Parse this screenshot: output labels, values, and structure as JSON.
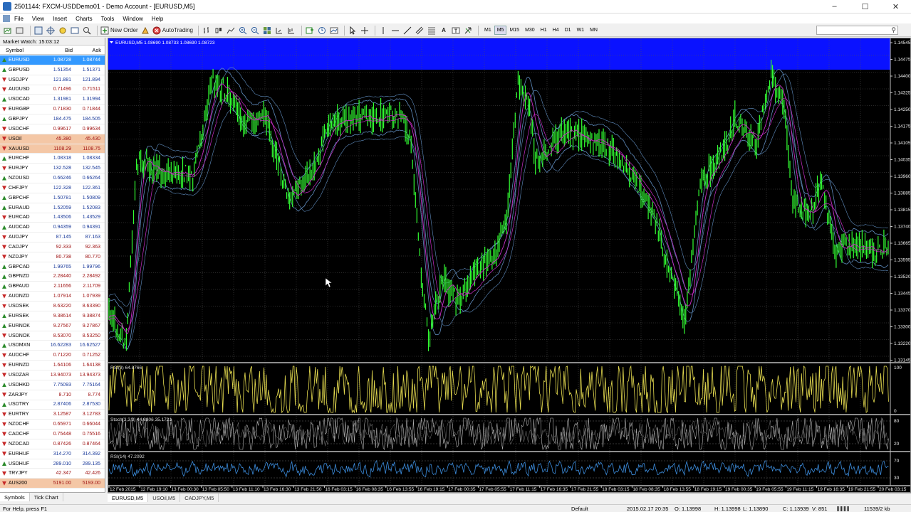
{
  "window": {
    "title": "2501144: FXCM-USDDemo01 - Demo Account - [EURUSD,M5]"
  },
  "menu": [
    "File",
    "View",
    "Insert",
    "Charts",
    "Tools",
    "Window",
    "Help"
  ],
  "toolbar": {
    "new_order": "New Order",
    "autotrading": "AutoTrading",
    "text_tool": "A",
    "timeframes": [
      "M1",
      "M5",
      "M15",
      "M30",
      "H1",
      "H4",
      "D1",
      "W1",
      "MN"
    ],
    "active_timeframe": "M5"
  },
  "market_watch": {
    "title": "Market Watch: 15:03:12",
    "headers": {
      "symbol": "Symbol",
      "bid": "Bid",
      "ask": "Ask"
    },
    "rows": [
      {
        "symbol": "EURUSD",
        "bid": "1.08728",
        "ask": "1.08744",
        "dir": "up",
        "state": "sel",
        "color": "b"
      },
      {
        "symbol": "GBPUSD",
        "bid": "1.51354",
        "ask": "1.51371",
        "dir": "up",
        "state": "",
        "color": "b"
      },
      {
        "symbol": "USDJPY",
        "bid": "121.881",
        "ask": "121.894",
        "dir": "down",
        "state": "",
        "color": "b"
      },
      {
        "symbol": "AUDUSD",
        "bid": "0.71496",
        "ask": "0.71511",
        "dir": "down",
        "state": "",
        "color": "r"
      },
      {
        "symbol": "USDCAD",
        "bid": "1.31981",
        "ask": "1.31994",
        "dir": "up",
        "state": "",
        "color": "b"
      },
      {
        "symbol": "EURGBP",
        "bid": "0.71830",
        "ask": "0.71844",
        "dir": "down",
        "state": "",
        "color": "r"
      },
      {
        "symbol": "GBPJPY",
        "bid": "184.475",
        "ask": "184.505",
        "dir": "up",
        "state": "",
        "color": "b"
      },
      {
        "symbol": "USDCHF",
        "bid": "0.99617",
        "ask": "0.99634",
        "dir": "down",
        "state": "",
        "color": "r"
      },
      {
        "symbol": "USOil",
        "bid": "45.380",
        "ask": "45.430",
        "dir": "down",
        "state": "hl",
        "color": "r"
      },
      {
        "symbol": "XAUUSD",
        "bid": "1108.29",
        "ask": "1108.75",
        "dir": "down",
        "state": "hl",
        "color": "r"
      },
      {
        "symbol": "EURCHF",
        "bid": "1.08318",
        "ask": "1.08334",
        "dir": "up",
        "state": "",
        "color": "b"
      },
      {
        "symbol": "EURJPY",
        "bid": "132.528",
        "ask": "132.545",
        "dir": "down",
        "state": "",
        "color": "b"
      },
      {
        "symbol": "NZDUSD",
        "bid": "0.66246",
        "ask": "0.66264",
        "dir": "up",
        "state": "",
        "color": "b"
      },
      {
        "symbol": "CHFJPY",
        "bid": "122.328",
        "ask": "122.361",
        "dir": "down",
        "state": "",
        "color": "b"
      },
      {
        "symbol": "GBPCHF",
        "bid": "1.50781",
        "ask": "1.50809",
        "dir": "up",
        "state": "",
        "color": "b"
      },
      {
        "symbol": "EURAUD",
        "bid": "1.52059",
        "ask": "1.52083",
        "dir": "up",
        "state": "",
        "color": "b"
      },
      {
        "symbol": "EURCAD",
        "bid": "1.43506",
        "ask": "1.43529",
        "dir": "down",
        "state": "",
        "color": "b"
      },
      {
        "symbol": "AUDCAD",
        "bid": "0.94359",
        "ask": "0.94391",
        "dir": "up",
        "state": "",
        "color": "b"
      },
      {
        "symbol": "AUDJPY",
        "bid": "87.145",
        "ask": "87.163",
        "dir": "down",
        "state": "",
        "color": "b"
      },
      {
        "symbol": "CADJPY",
        "bid": "92.333",
        "ask": "92.363",
        "dir": "down",
        "state": "",
        "color": "r"
      },
      {
        "symbol": "NZDJPY",
        "bid": "80.738",
        "ask": "80.770",
        "dir": "down",
        "state": "",
        "color": "r"
      },
      {
        "symbol": "GBPCAD",
        "bid": "1.99765",
        "ask": "1.99796",
        "dir": "up",
        "state": "",
        "color": "b"
      },
      {
        "symbol": "GBPNZD",
        "bid": "2.28440",
        "ask": "2.28492",
        "dir": "up",
        "state": "",
        "color": "r"
      },
      {
        "symbol": "GBPAUD",
        "bid": "2.11656",
        "ask": "2.11709",
        "dir": "up",
        "state": "",
        "color": "r"
      },
      {
        "symbol": "AUDNZD",
        "bid": "1.07914",
        "ask": "1.07939",
        "dir": "down",
        "state": "",
        "color": "r"
      },
      {
        "symbol": "USDSEK",
        "bid": "8.63220",
        "ask": "8.63390",
        "dir": "down",
        "state": "",
        "color": "r"
      },
      {
        "symbol": "EURSEK",
        "bid": "9.38614",
        "ask": "9.38874",
        "dir": "up",
        "state": "",
        "color": "r"
      },
      {
        "symbol": "EURNOK",
        "bid": "9.27567",
        "ask": "9.27867",
        "dir": "up",
        "state": "",
        "color": "r"
      },
      {
        "symbol": "USDNOK",
        "bid": "8.53070",
        "ask": "8.53250",
        "dir": "down",
        "state": "",
        "color": "r"
      },
      {
        "symbol": "USDMXN",
        "bid": "16.62283",
        "ask": "16.62527",
        "dir": "up",
        "state": "",
        "color": "b"
      },
      {
        "symbol": "AUDCHF",
        "bid": "0.71220",
        "ask": "0.71252",
        "dir": "down",
        "state": "",
        "color": "r"
      },
      {
        "symbol": "EURNZD",
        "bid": "1.64106",
        "ask": "1.64138",
        "dir": "down",
        "state": "",
        "color": "r"
      },
      {
        "symbol": "USDZAR",
        "bid": "13.94073",
        "ask": "13.94373",
        "dir": "down",
        "state": "",
        "color": "r"
      },
      {
        "symbol": "USDHKD",
        "bid": "7.75093",
        "ask": "7.75164",
        "dir": "up",
        "state": "",
        "color": "b"
      },
      {
        "symbol": "ZARJPY",
        "bid": "8.710",
        "ask": "8.774",
        "dir": "down",
        "state": "",
        "color": "r"
      },
      {
        "symbol": "USDTRY",
        "bid": "2.87406",
        "ask": "2.87530",
        "dir": "up",
        "state": "",
        "color": "b"
      },
      {
        "symbol": "EURTRY",
        "bid": "3.12587",
        "ask": "3.12783",
        "dir": "down",
        "state": "",
        "color": "r"
      },
      {
        "symbol": "NZDCHF",
        "bid": "0.65971",
        "ask": "0.66044",
        "dir": "down",
        "state": "",
        "color": "r"
      },
      {
        "symbol": "CADCHF",
        "bid": "0.75448",
        "ask": "0.75516",
        "dir": "down",
        "state": "",
        "color": "r"
      },
      {
        "symbol": "NZDCAD",
        "bid": "0.87426",
        "ask": "0.87464",
        "dir": "down",
        "state": "",
        "color": "r"
      },
      {
        "symbol": "EURHUF",
        "bid": "314.270",
        "ask": "314.392",
        "dir": "down",
        "state": "",
        "color": "b"
      },
      {
        "symbol": "USDHUF",
        "bid": "289.010",
        "ask": "289.135",
        "dir": "up",
        "state": "",
        "color": "b"
      },
      {
        "symbol": "TRYJPY",
        "bid": "42.347",
        "ask": "42.426",
        "dir": "down",
        "state": "",
        "color": "r"
      },
      {
        "symbol": "AUS200",
        "bid": "5191.00",
        "ask": "5193.00",
        "dir": "down",
        "state": "hl",
        "color": "r"
      }
    ],
    "tabs": [
      "Symbols",
      "Tick Chart"
    ],
    "active_tab": "Symbols"
  },
  "chart": {
    "header": "EURUSD,M5 1.08690 1.08733 1.08690 1.08723",
    "price_levels": [
      "1.14545",
      "1.14475",
      "1.14400",
      "1.14325",
      "1.14250",
      "1.14175",
      "1.14105",
      "1.14035",
      "1.13960",
      "1.13885",
      "1.13815",
      "1.13740",
      "1.13665",
      "1.13595",
      "1.13520",
      "1.13445",
      "1.13370",
      "1.13300",
      "1.13220",
      "1.13145"
    ],
    "rsi1_label": "RSI(3) 64.8766",
    "rsi1_levels": [
      "100",
      "0"
    ],
    "stoch_label": "Stoch(3,3,3) 44.8806 35.1721",
    "stoch_levels": [
      "80",
      "20"
    ],
    "rsi2_label": "RSI(14) 47.2092",
    "rsi2_levels": [
      "70",
      "30"
    ],
    "time_labels": [
      "12 Feb 2015",
      "12 Feb 19:10",
      "13 Feb 00:30",
      "13 Feb 05:50",
      "13 Feb 11:10",
      "13 Feb 16:30",
      "13 Feb 21:50",
      "16 Feb 03:15",
      "16 Feb 08:35",
      "16 Feb 13:55",
      "16 Feb 19:15",
      "17 Feb 00:35",
      "17 Feb 05:55",
      "17 Feb 11:15",
      "17 Feb 16:35",
      "17 Feb 21:55",
      "18 Feb 03:15",
      "18 Feb 08:35",
      "18 Feb 13:55",
      "18 Feb 19:15",
      "19 Feb 00:35",
      "19 Feb 05:55",
      "19 Feb 11:15",
      "19 Feb 16:35",
      "19 Feb 21:55",
      "20 Feb 03:15"
    ],
    "colors": {
      "bg": "#000000",
      "candles": "#32ff32",
      "band": "#5f8cbe",
      "ma": "#c82dc8",
      "rsi": "#e6dc50",
      "stoch": "#b4b4b4",
      "rsi14": "#3c8cdc",
      "highlight": "#0a12ff"
    }
  },
  "chart_tabs": [
    "EURUSD,M5",
    "USOil,M5",
    "CADJPY,M5"
  ],
  "active_chart_tab": "EURUSD,M5",
  "status": {
    "help": "For Help, press F1",
    "profile": "Default",
    "datetime": "2015.02.17 20:35",
    "open": "O: 1.13998",
    "high": "H: 1.13998",
    "low": "L: 1.13890",
    "close": "C: 1.13939",
    "volume": "V: 851",
    "traffic": "11539/2 kb"
  }
}
